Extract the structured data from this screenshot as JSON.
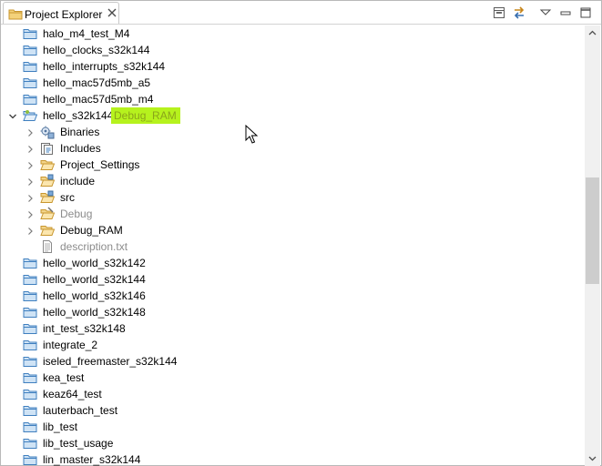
{
  "view": {
    "title": "Project Explorer",
    "close_icon": "close-icon",
    "toolbar": [
      "collapse-all-icon",
      "link-with-editor-icon",
      "view-menu-icon",
      "minimize-icon",
      "maximize-icon"
    ]
  },
  "tree": {
    "items": [
      {
        "label": "halo_m4_test_M4",
        "kind": "project",
        "depth": 0,
        "twisty": "none",
        "decoration": ""
      },
      {
        "label": "hello_clocks_s32k144",
        "kind": "project",
        "depth": 0,
        "twisty": "none",
        "decoration": ""
      },
      {
        "label": "hello_interrupts_s32k144",
        "kind": "project",
        "depth": 0,
        "twisty": "none",
        "decoration": ""
      },
      {
        "label": "hello_mac57d5mb_a5",
        "kind": "project",
        "depth": 0,
        "twisty": "none",
        "decoration": ""
      },
      {
        "label": "hello_mac57d5mb_m4",
        "kind": "project",
        "depth": 0,
        "twisty": "none",
        "decoration": ""
      },
      {
        "label": "hello_s32k144",
        "kind": "project-open",
        "depth": 0,
        "twisty": "expanded",
        "decoration": "Debug_RAM"
      },
      {
        "label": "Binaries",
        "kind": "binaries",
        "depth": 1,
        "twisty": "collapsed",
        "decoration": ""
      },
      {
        "label": "Includes",
        "kind": "includes",
        "depth": 1,
        "twisty": "collapsed",
        "decoration": ""
      },
      {
        "label": "Project_Settings",
        "kind": "folder",
        "depth": 1,
        "twisty": "collapsed",
        "decoration": ""
      },
      {
        "label": "include",
        "kind": "source-folder",
        "depth": 1,
        "twisty": "collapsed",
        "decoration": ""
      },
      {
        "label": "src",
        "kind": "source-folder",
        "depth": 1,
        "twisty": "collapsed",
        "decoration": ""
      },
      {
        "label": "Debug",
        "kind": "folder-derived",
        "depth": 1,
        "twisty": "collapsed",
        "decoration": ""
      },
      {
        "label": "Debug_RAM",
        "kind": "folder",
        "depth": 1,
        "twisty": "collapsed",
        "decoration": ""
      },
      {
        "label": "description.txt",
        "kind": "file",
        "depth": 1,
        "twisty": "none",
        "decoration": ""
      },
      {
        "label": "hello_world_s32k142",
        "kind": "project",
        "depth": 0,
        "twisty": "none",
        "decoration": ""
      },
      {
        "label": "hello_world_s32k144",
        "kind": "project",
        "depth": 0,
        "twisty": "none",
        "decoration": ""
      },
      {
        "label": "hello_world_s32k146",
        "kind": "project",
        "depth": 0,
        "twisty": "none",
        "decoration": ""
      },
      {
        "label": "hello_world_s32k148",
        "kind": "project",
        "depth": 0,
        "twisty": "none",
        "decoration": ""
      },
      {
        "label": "int_test_s32k148",
        "kind": "project",
        "depth": 0,
        "twisty": "none",
        "decoration": ""
      },
      {
        "label": "integrate_2",
        "kind": "project",
        "depth": 0,
        "twisty": "none",
        "decoration": ""
      },
      {
        "label": "iseled_freemaster_s32k144",
        "kind": "project",
        "depth": 0,
        "twisty": "none",
        "decoration": ""
      },
      {
        "label": "kea_test",
        "kind": "project",
        "depth": 0,
        "twisty": "none",
        "decoration": ""
      },
      {
        "label": "keaz64_test",
        "kind": "project",
        "depth": 0,
        "twisty": "none",
        "decoration": ""
      },
      {
        "label": "lauterbach_test",
        "kind": "project",
        "depth": 0,
        "twisty": "none",
        "decoration": ""
      },
      {
        "label": "lib_test",
        "kind": "project",
        "depth": 0,
        "twisty": "none",
        "decoration": ""
      },
      {
        "label": "lib_test_usage",
        "kind": "project",
        "depth": 0,
        "twisty": "none",
        "decoration": ""
      },
      {
        "label": "lin_master_s32k144",
        "kind": "project",
        "depth": 0,
        "twisty": "none",
        "decoration": ""
      }
    ]
  },
  "scrollbar": {
    "position": 0.45,
    "visible_fraction": 0.26
  },
  "colors": {
    "decoration_bg": "#b6f21d",
    "decoration_fg": "#8ba51a",
    "folder_fill": "#cfe3f5",
    "folder_stroke": "#3f7fbf"
  }
}
